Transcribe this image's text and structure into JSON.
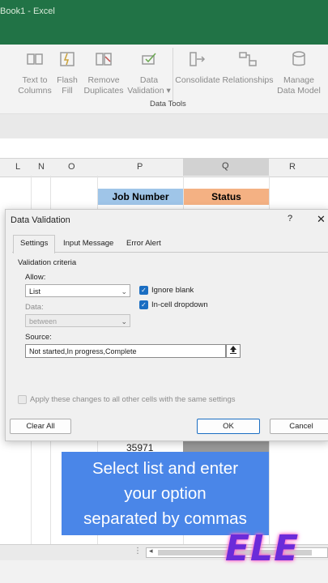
{
  "window": {
    "title": "Book1  -  Excel"
  },
  "ribbon": {
    "buttons": [
      {
        "label": "Text to\nColumns"
      },
      {
        "label": "Flash\nFill"
      },
      {
        "label": "Remove\nDuplicates"
      },
      {
        "label": "Data\nValidation ▾"
      },
      {
        "label": "Consolidate"
      },
      {
        "label": "Relationships"
      },
      {
        "label": "Manage\nData Model"
      }
    ],
    "group_label": "Data Tools"
  },
  "sheet": {
    "columns": [
      "L",
      "N",
      "O",
      "P",
      "Q",
      "R"
    ],
    "header_job": "Job Number",
    "header_status": "Status",
    "visible_value": "35971",
    "colors": {
      "job_header_bg": "#9fc5e8",
      "status_header_bg": "#f4b183"
    }
  },
  "dialog": {
    "title": "Data Validation",
    "help": "?",
    "close": "✕",
    "tabs": [
      "Settings",
      "Input Message",
      "Error Alert"
    ],
    "validation_criteria_label": "Validation criteria",
    "allow_label": "Allow:",
    "allow_value": "List",
    "ignore_blank_label": "Ignore blank",
    "in_cell_dropdown_label": "In-cell dropdown",
    "data_label": "Data:",
    "data_value": "between",
    "source_label": "Source:",
    "source_value": "Not started,In progress,Complete",
    "apply_all_label": "Apply these changes to all other cells with the same settings",
    "clear_all": "Clear All",
    "ok": "OK",
    "cancel": "Cancel"
  },
  "caption": {
    "line1": "Select list and enter",
    "line2": "your option",
    "line3": "separated by commas"
  },
  "logo": {
    "text": "ELE"
  },
  "colors": {
    "excel_green": "#217346",
    "caption_blue": "#4a86e8",
    "checkbox_blue": "#1b6ec2"
  }
}
